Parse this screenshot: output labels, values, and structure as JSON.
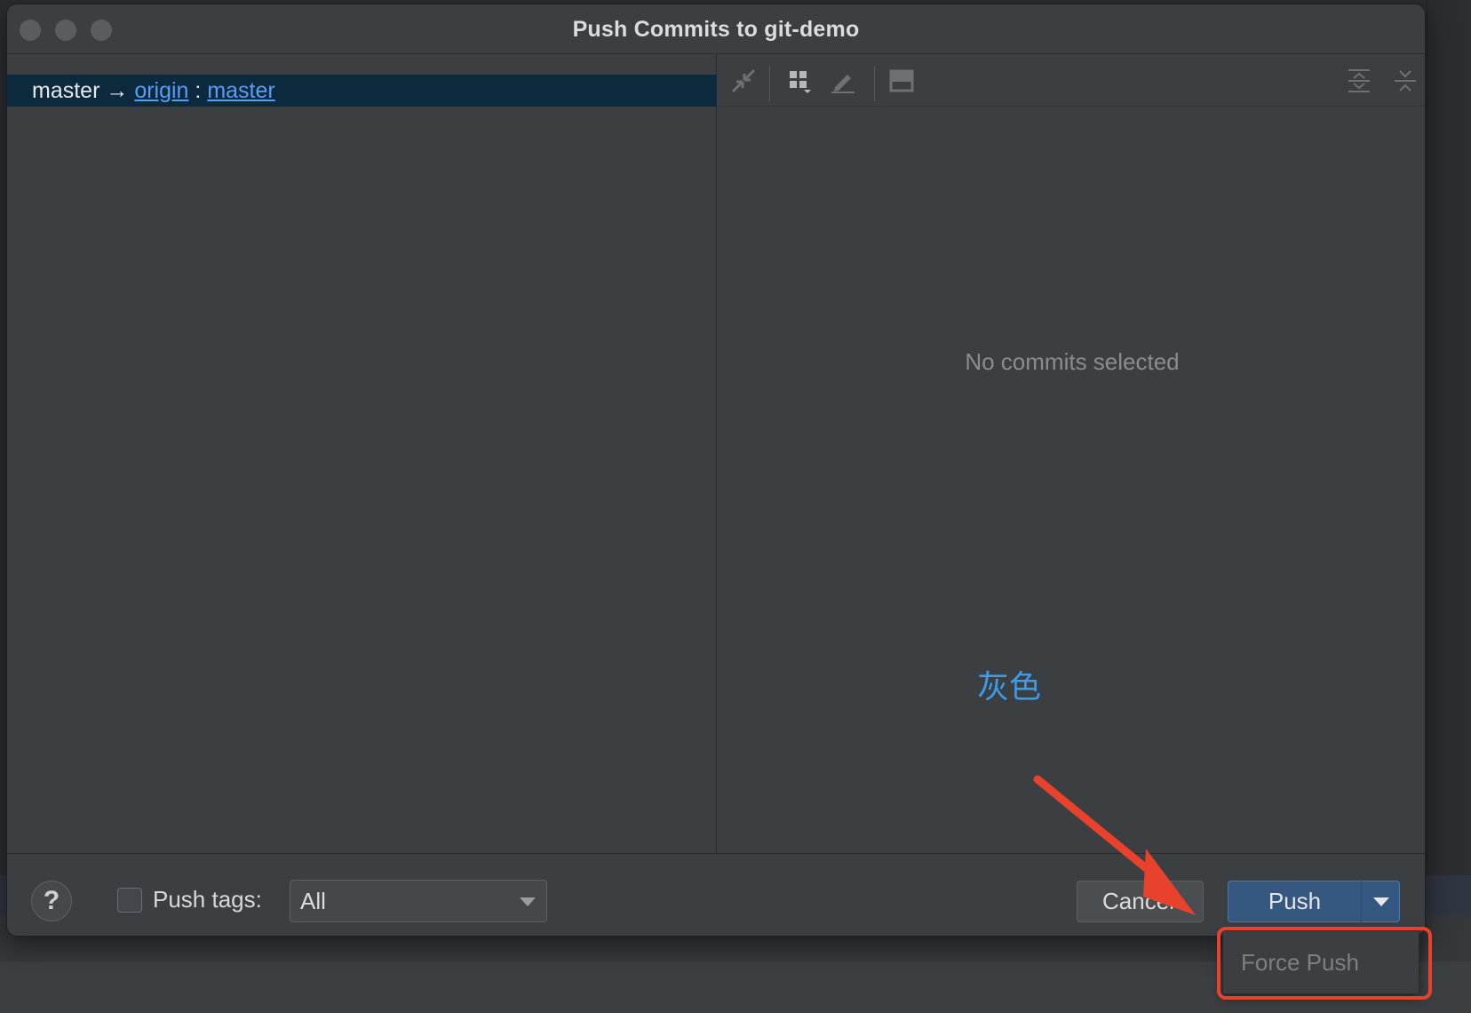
{
  "dialog": {
    "title": "Push Commits to git-demo"
  },
  "branch_row": {
    "local": "master",
    "arrow": "→",
    "remote": "origin",
    "separator": ":",
    "remote_branch": "master"
  },
  "details": {
    "empty_message": "No commits selected"
  },
  "annotation": {
    "text": "灰色",
    "arrow_color": "#e8412c",
    "text_color": "#3d9be9"
  },
  "bottom": {
    "help_label": "?",
    "push_tags_label": "Push tags:",
    "push_tags_checked": false,
    "tags_select_value": "All",
    "cancel_label": "Cancel",
    "push_label": "Push"
  },
  "popup": {
    "force_push_label": "Force Push"
  },
  "toolbar": {
    "icons": [
      "expand-collapse-icon",
      "group-by-icon",
      "edit-icon",
      "preview-icon",
      "expand-all-icon",
      "collapse-all-icon"
    ]
  }
}
